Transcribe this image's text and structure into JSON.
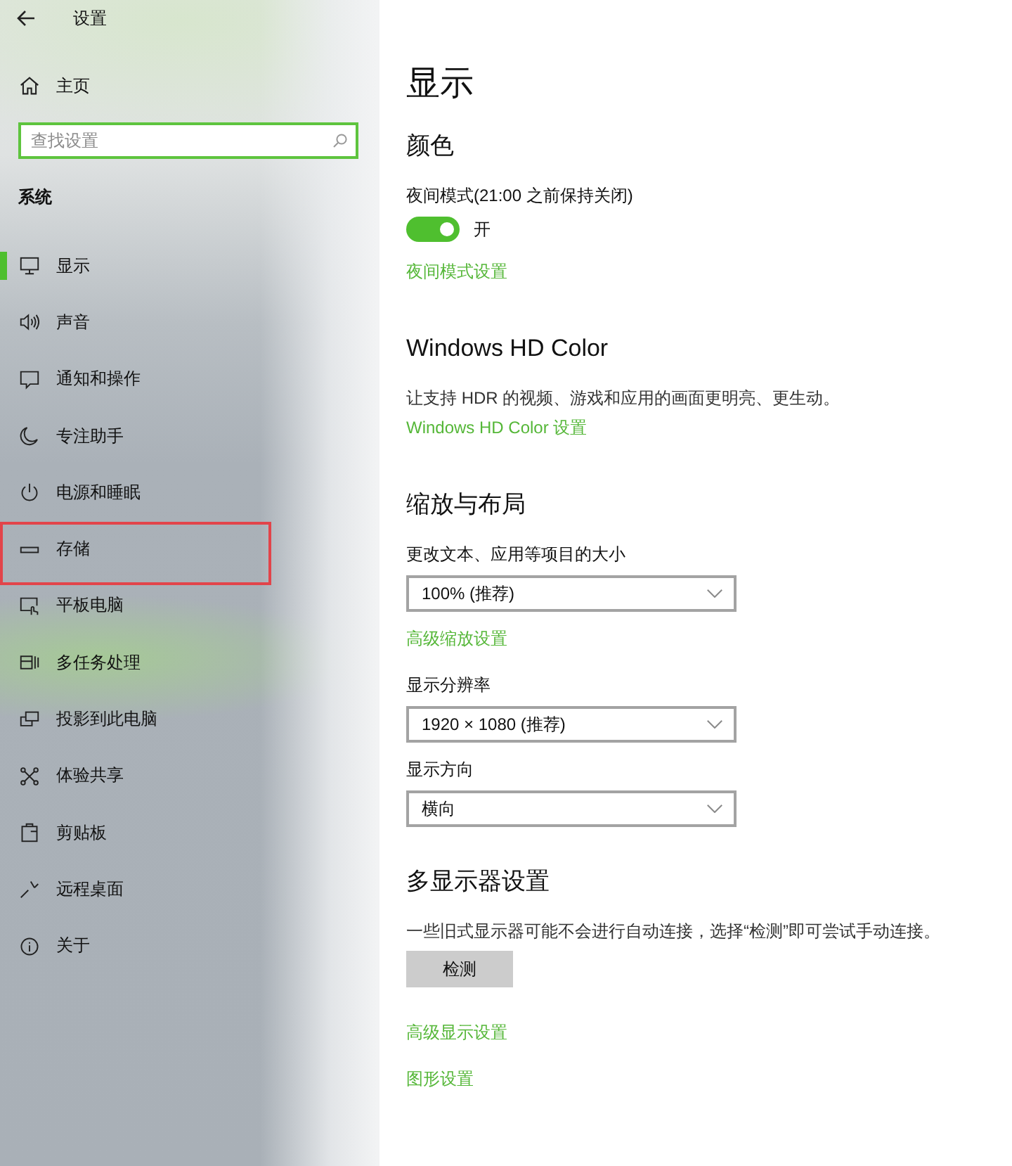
{
  "window": {
    "title": "设置"
  },
  "sidebar": {
    "home": "主页",
    "search": {
      "placeholder": "查找设置"
    },
    "section": "系统",
    "items": [
      {
        "label": "显示",
        "selected": true,
        "highlighted": false
      },
      {
        "label": "声音",
        "selected": false,
        "highlighted": false
      },
      {
        "label": "通知和操作",
        "selected": false,
        "highlighted": false
      },
      {
        "label": "专注助手",
        "selected": false,
        "highlighted": false
      },
      {
        "label": "电源和睡眠",
        "selected": false,
        "highlighted": false
      },
      {
        "label": "存储",
        "selected": false,
        "highlighted": true
      },
      {
        "label": "平板电脑",
        "selected": false,
        "highlighted": false
      },
      {
        "label": "多任务处理",
        "selected": false,
        "highlighted": false
      },
      {
        "label": "投影到此电脑",
        "selected": false,
        "highlighted": false
      },
      {
        "label": "体验共享",
        "selected": false,
        "highlighted": false
      },
      {
        "label": "剪贴板",
        "selected": false,
        "highlighted": false
      },
      {
        "label": "远程桌面",
        "selected": false,
        "highlighted": false
      },
      {
        "label": "关于",
        "selected": false,
        "highlighted": false
      }
    ]
  },
  "page": {
    "title": "显示",
    "sections": [
      {
        "heading": "颜色",
        "items": [
          {
            "kind": "label",
            "text": "夜间模式(21:00 之前保持关闭)"
          },
          {
            "kind": "toggle",
            "on": true,
            "text": "开"
          },
          {
            "kind": "link",
            "text": "夜间模式设置"
          }
        ]
      },
      {
        "heading": "Windows HD Color",
        "items": [
          {
            "kind": "text",
            "text": "让支持 HDR 的视频、游戏和应用的画面更明亮、更生动。"
          },
          {
            "kind": "link",
            "text": "Windows HD Color 设置"
          }
        ]
      },
      {
        "heading": "缩放与布局",
        "items": [
          {
            "kind": "label",
            "text": "更改文本、应用等项目的大小"
          },
          {
            "kind": "dropdown",
            "value": "100% (推荐)"
          },
          {
            "kind": "link",
            "text": "高级缩放设置"
          },
          {
            "kind": "label",
            "text": "显示分辨率"
          },
          {
            "kind": "dropdown",
            "value": "1920 × 1080 (推荐)"
          },
          {
            "kind": "label",
            "text": "显示方向"
          },
          {
            "kind": "dropdown",
            "value": "横向"
          }
        ]
      },
      {
        "heading": "多显示器设置",
        "items": [
          {
            "kind": "text",
            "text": "一些旧式显示器可能不会进行自动连接，选择“检测”即可尝试手动连接。"
          },
          {
            "kind": "button",
            "text": "检测"
          },
          {
            "kind": "link",
            "text": "高级显示设置"
          },
          {
            "kind": "link",
            "text": "图形设置"
          }
        ]
      }
    ]
  }
}
